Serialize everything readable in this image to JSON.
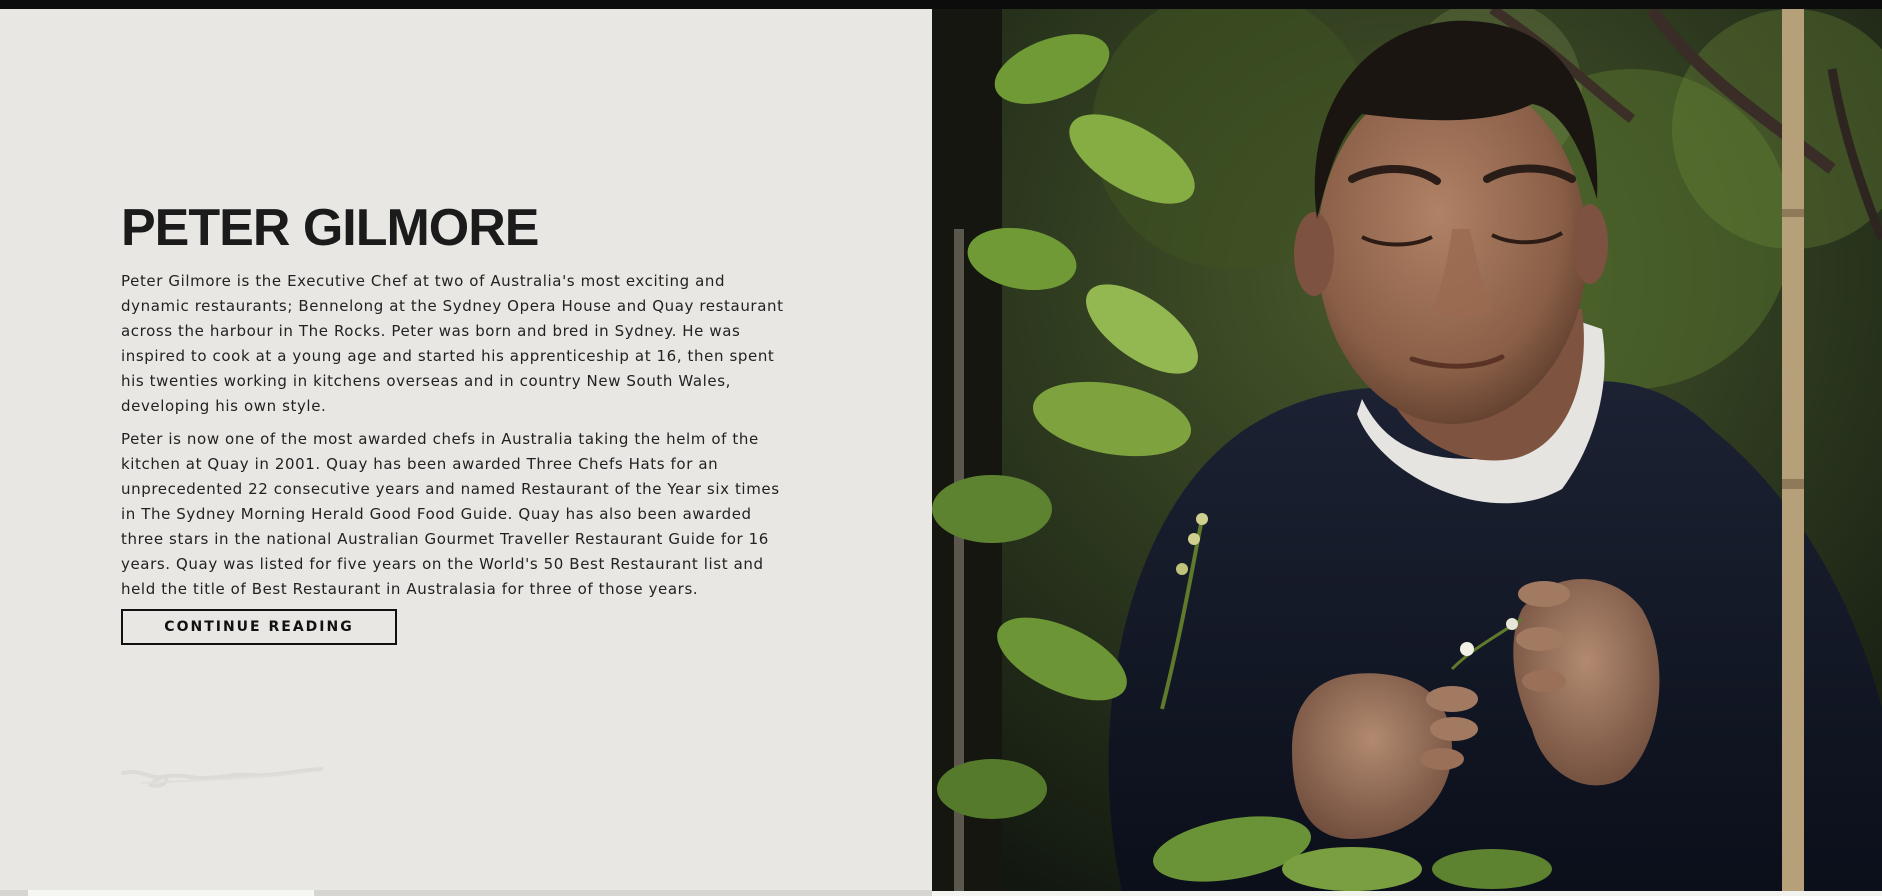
{
  "bio": {
    "name": "PETER GILMORE",
    "paragraph_1": "Peter Gilmore is the Executive Chef at two of Australia's most exciting and dynamic restaurants; Bennelong at the Sydney Opera House and Quay restaurant across the harbour in The Rocks. Peter was born and bred in Sydney. He was inspired to cook at a young age and started his apprenticeship at 16, then spent his twenties working in kitchens overseas and in country New South Wales, developing his own style.",
    "paragraph_2": "Peter is now one of the most awarded chefs in Australia taking the helm of the kitchen at Quay in 2001. Quay has been awarded Three Chefs Hats for an unprecedented 22 consecutive years and named Restaurant of the Year six times in The Sydney Morning Herald Good Food Guide. Quay has also been awarded three stars in the national Australian Gourmet Traveller Restaurant Guide for 16 years. Quay was listed for five years on the World's 50 Best Restaurant list and held the title of Best Restaurant in Australasia for three of those years.",
    "cta_label": "CONTINUE READING"
  },
  "colors": {
    "background": "#e8e7e3",
    "text": "#1b1b1b",
    "topbar": "#0c0c0c"
  },
  "icons": {
    "signature": "handwritten-signature"
  }
}
